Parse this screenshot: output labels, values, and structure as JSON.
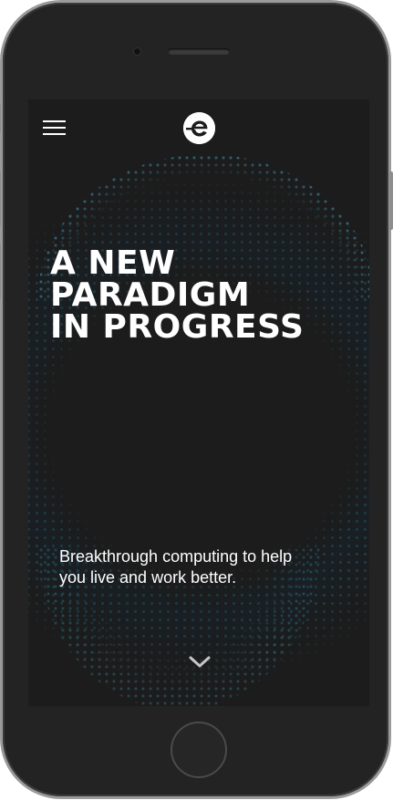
{
  "device": {
    "frame_color": "#232323"
  },
  "header": {
    "menu_icon": "hamburger-menu-icon",
    "logo_icon": "e-logo-icon"
  },
  "hero": {
    "headline_lines": [
      "A NEW",
      "PARADIGM",
      "IN PROGRESS"
    ],
    "tagline_lines": [
      "Breakthrough computing to help",
      "you live and work better."
    ],
    "scroll_icon": "chevron-down-icon",
    "accent_color": "#3fa9d6",
    "background_color": "#1c1c1c"
  }
}
